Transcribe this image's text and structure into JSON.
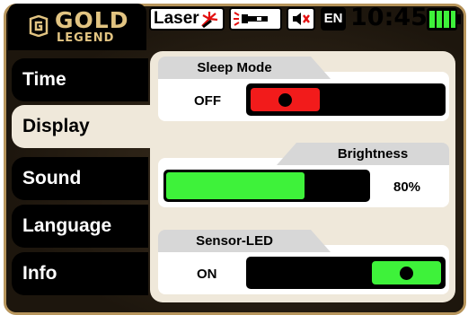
{
  "brand": {
    "word1": "GOLD",
    "word2": "LEGEND",
    "accent": "#e2c482"
  },
  "status_bar": {
    "laser_label": "Laser",
    "language": "EN",
    "time": "10:45",
    "battery_level": 1.0,
    "icons": [
      "laser-icon",
      "flashlight-icon",
      "speaker-muted-icon",
      "battery-icon"
    ]
  },
  "nav": {
    "items": [
      {
        "label": "Time"
      },
      {
        "label": "Display"
      },
      {
        "label": "Sound"
      },
      {
        "label": "Language"
      },
      {
        "label": "Info"
      }
    ],
    "active": "Display"
  },
  "settings": {
    "sleep_mode": {
      "title": "Sleep Mode",
      "value": "OFF",
      "state": false,
      "color": "#f21b1b"
    },
    "brightness": {
      "title": "Brightness",
      "value": "80%",
      "percent": 80,
      "color": "#3ef23a"
    },
    "sensor_led": {
      "title": "Sensor-LED",
      "value": "ON",
      "state": true,
      "color": "#3ef23a"
    }
  }
}
